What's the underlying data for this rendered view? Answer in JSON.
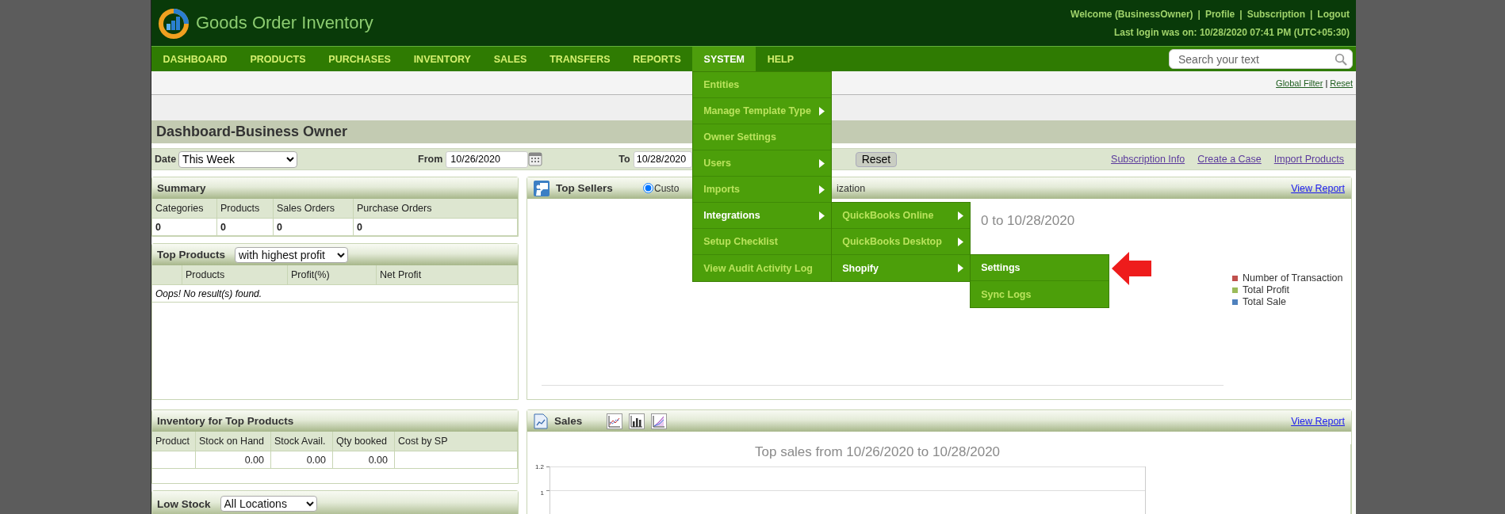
{
  "header": {
    "app_title": "Goods Order Inventory",
    "links": [
      "Welcome (BusinessOwner)",
      "Profile",
      "Subscription",
      "Logout"
    ],
    "separator": "|",
    "last_login": "Last login was on: 10/28/2020 07:41 PM (UTC+05:30)"
  },
  "nav": [
    {
      "label": "DASHBOARD",
      "selected": false
    },
    {
      "label": "PRODUCTS",
      "selected": false
    },
    {
      "label": "PURCHASES",
      "selected": false
    },
    {
      "label": "INVENTORY",
      "selected": false
    },
    {
      "label": "SALES",
      "selected": false
    },
    {
      "label": "TRANSFERS",
      "selected": false
    },
    {
      "label": "REPORTS",
      "selected": false
    },
    {
      "label": "SYSTEM",
      "selected": true,
      "menu": [
        {
          "label": "Entities",
          "submenu": false,
          "selected": false
        },
        {
          "label": "Manage Template Type",
          "submenu": true,
          "selected": false
        },
        {
          "label": "Owner Settings",
          "submenu": false,
          "selected": false
        },
        {
          "label": "Users",
          "submenu": true,
          "selected": false
        },
        {
          "label": "Imports",
          "submenu": true,
          "selected": false
        },
        {
          "label": "Integrations",
          "submenu": true,
          "selected": true,
          "children": [
            {
              "label": "QuickBooks Online",
              "submenu": true,
              "selected": false
            },
            {
              "label": "QuickBooks Desktop",
              "submenu": true,
              "selected": false
            },
            {
              "label": "Shopify",
              "submenu": true,
              "selected": true,
              "children": [
                {
                  "label": "Settings",
                  "submenu": false,
                  "selected": true
                },
                {
                  "label": "Sync Logs",
                  "submenu": false,
                  "selected": false
                }
              ]
            }
          ]
        },
        {
          "label": "Setup Checklist",
          "submenu": false,
          "selected": false
        },
        {
          "label": "View Audit Activity Log",
          "submenu": false,
          "selected": false
        }
      ]
    },
    {
      "label": "HELP",
      "selected": false
    }
  ],
  "search": {
    "placeholder": "Search your text"
  },
  "filter_links": {
    "items": [
      "Global Filter",
      "Reset"
    ],
    "separator": "|"
  },
  "page_title": "Dashboard-Business Owner",
  "date_filter": {
    "date_label": "Date",
    "date_value": "This Week",
    "from_label": "From",
    "from_value": "10/26/2020",
    "to_label": "To",
    "to_value": "10/28/2020",
    "reset_button": "Reset",
    "links": [
      "Subscription Info",
      "Create a Case",
      "Import Products"
    ]
  },
  "summary": {
    "title": "Summary",
    "columns": [
      "Categories",
      "Products",
      "Sales Orders",
      "Purchase Orders"
    ],
    "values": [
      "0",
      "0",
      "0",
      "0"
    ]
  },
  "top_products": {
    "title": "Top Products",
    "filter": "with highest profit",
    "columns": [
      "Products",
      "Profit(%)",
      "Net Profit"
    ],
    "empty_message": "Oops! No result(s) found."
  },
  "inventory": {
    "title": "Inventory for Top Products",
    "columns": [
      "Product",
      "Stock on Hand",
      "Stock Avail.",
      "Qty booked",
      "Cost by SP"
    ],
    "values": [
      "0.00",
      "0.00",
      "0.00"
    ]
  },
  "low_stock": {
    "title": "Low Stock",
    "filter": "All Locations"
  },
  "top_sellers": {
    "title": "Top Sellers",
    "radio": {
      "label": "Custo",
      "selected": true
    },
    "label_tail": "ization",
    "view_link": "View Report",
    "chart_title": "0 to 10/28/2020",
    "legend": [
      {
        "label": "Number of Transaction",
        "color": "#c0504d"
      },
      {
        "label": "Total Profit",
        "color": "#9bbb59"
      },
      {
        "label": "Total Sale",
        "color": "#4f81bd"
      }
    ]
  },
  "sales": {
    "title": "Sales",
    "view_link": "View Report",
    "chart_title": "Top sales from 10/26/2020 to 10/28/2020",
    "y_ticks": [
      "1.2",
      "1"
    ]
  }
}
